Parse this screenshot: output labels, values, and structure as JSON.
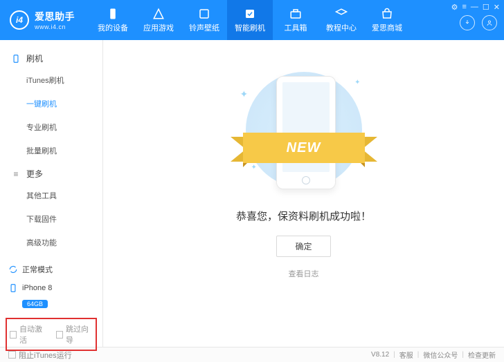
{
  "brand": {
    "name": "爱思助手",
    "url": "www.i4.cn",
    "logo_text": "i4"
  },
  "tabs": [
    {
      "label": "我的设备"
    },
    {
      "label": "应用游戏"
    },
    {
      "label": "铃声壁纸"
    },
    {
      "label": "智能刷机"
    },
    {
      "label": "工具箱"
    },
    {
      "label": "教程中心"
    },
    {
      "label": "爱思商城"
    }
  ],
  "sidebar": {
    "sec1": {
      "title": "刷机",
      "items": [
        "iTunes刷机",
        "一键刷机",
        "专业刷机",
        "批量刷机"
      ]
    },
    "sec2": {
      "title": "更多",
      "items": [
        "其他工具",
        "下载固件",
        "高级功能"
      ]
    },
    "mode": "正常模式",
    "device": "iPhone 8",
    "storage": "64GB",
    "opt_auto_activate": "自动激活",
    "opt_skip_guide": "跳过向导"
  },
  "main": {
    "ribbon_text": "NEW",
    "success_message": "恭喜您，保资料刷机成功啦！",
    "confirm_button": "确定",
    "log_link": "查看日志"
  },
  "footer": {
    "block_itunes": "阻止iTunes运行",
    "version": "V8.12",
    "support": "客服",
    "wechat": "微信公众号",
    "update": "检查更新"
  }
}
